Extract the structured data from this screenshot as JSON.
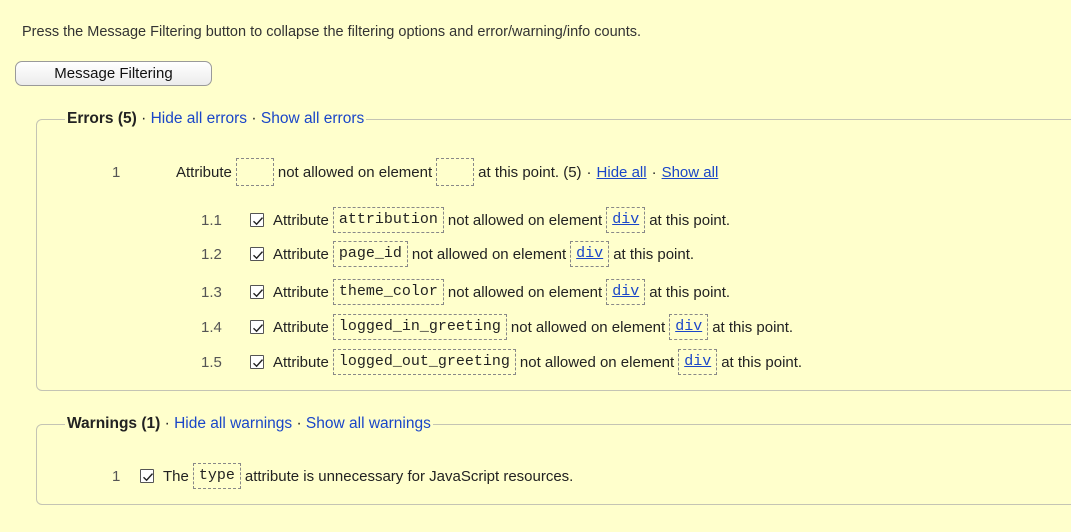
{
  "intro_text": "Press the Message Filtering button to collapse the filtering options and error/warning/info counts.",
  "filter_button_label": "Message Filtering",
  "errors": {
    "title": "Errors (5)",
    "sep": "·",
    "hide_all": "Hide all errors",
    "show_all": "Show all errors",
    "group": {
      "number": "1",
      "prefix": "Attribute",
      "middle": "not allowed on element",
      "suffix": "at this point. (5)",
      "sep": "·",
      "hide_all": "Hide all",
      "show_all": "Show all"
    },
    "items": [
      {
        "number": "1.1",
        "checked": true,
        "attribute": "attribution",
        "element": "div"
      },
      {
        "number": "1.2",
        "checked": true,
        "attribute": "page_id",
        "element": "div"
      },
      {
        "number": "1.3",
        "checked": true,
        "attribute": "theme_color",
        "element": "div"
      },
      {
        "number": "1.4",
        "checked": true,
        "attribute": "logged_in_greeting",
        "element": "div"
      },
      {
        "number": "1.5",
        "checked": true,
        "attribute": "logged_out_greeting",
        "element": "div"
      }
    ],
    "item_prefix": "Attribute",
    "item_middle": "not allowed on element",
    "item_suffix": "at this point."
  },
  "warnings": {
    "title": "Warnings (1)",
    "sep": "·",
    "hide_all": "Hide all warnings",
    "show_all": "Show all warnings",
    "items": [
      {
        "number": "1",
        "checked": true,
        "prefix": "The",
        "code": "type",
        "suffix": "attribute is unnecessary for JavaScript resources."
      }
    ]
  },
  "colors": {
    "background": "#ffffcc",
    "link": "#1a46c8"
  }
}
